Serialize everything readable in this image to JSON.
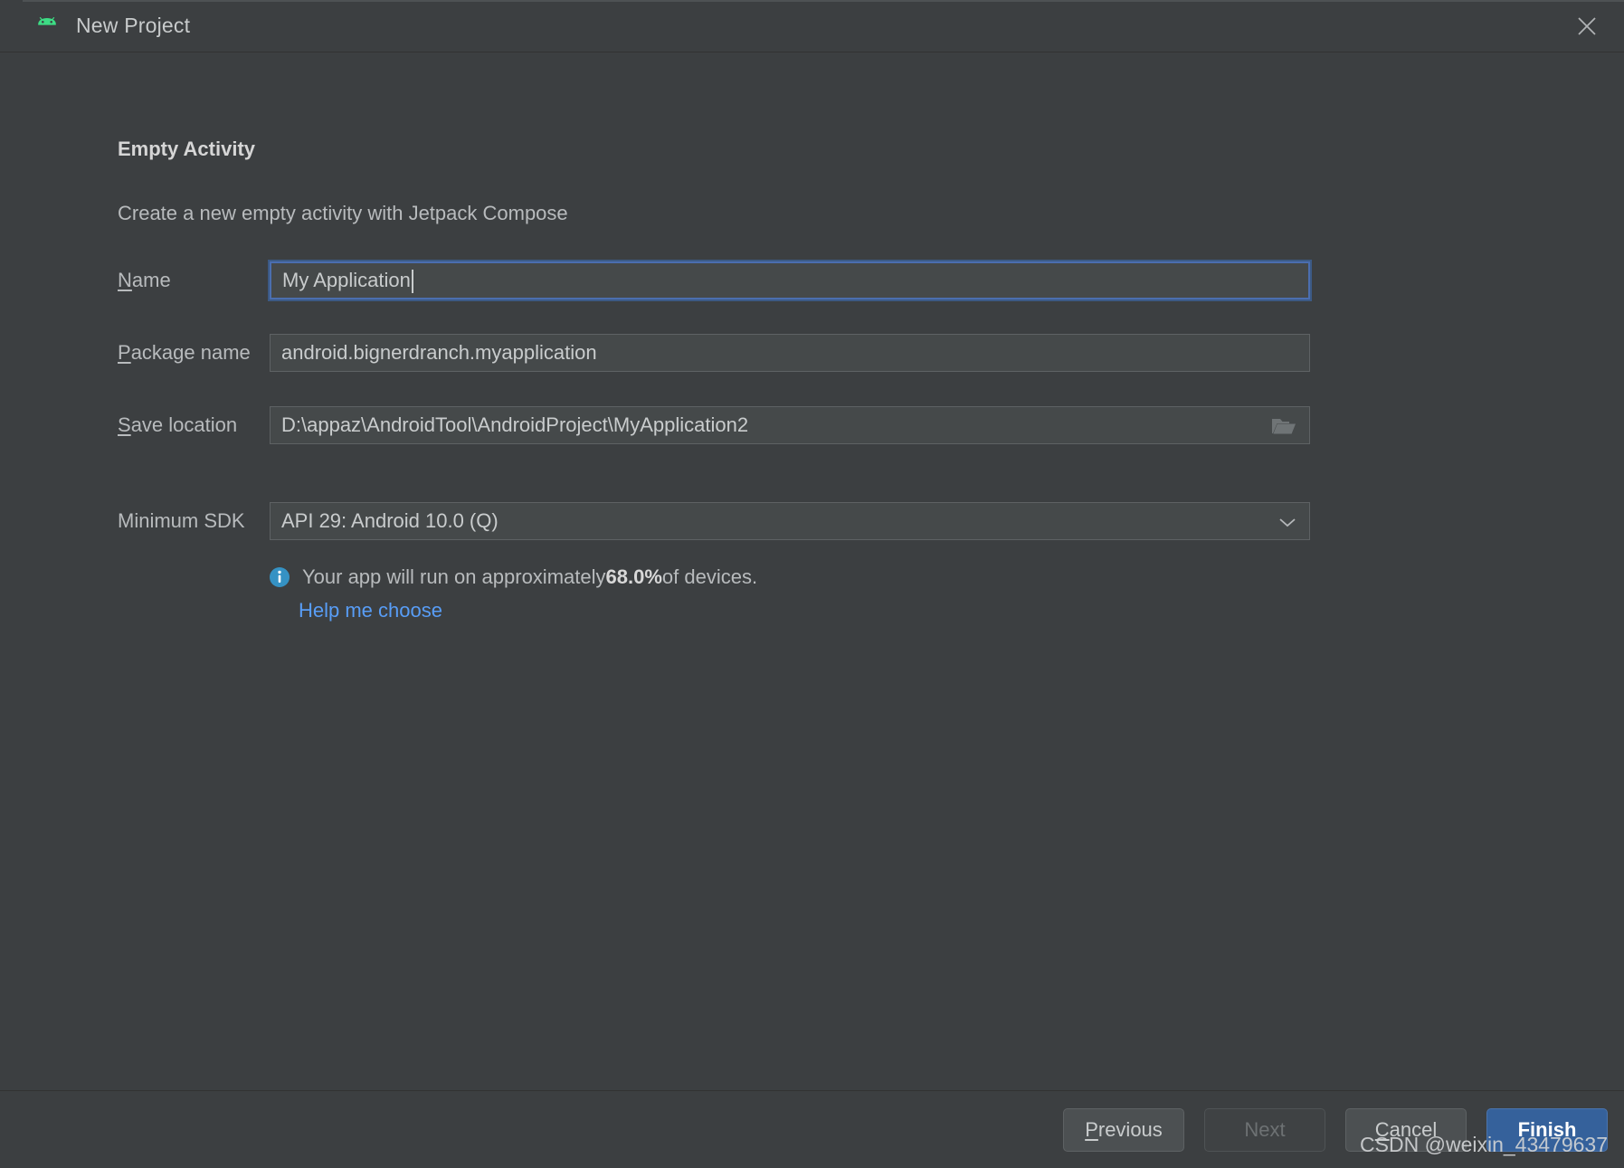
{
  "window": {
    "title": "New Project",
    "app_icon": "android-robot-icon",
    "close_icon": "close-icon"
  },
  "step": {
    "title": "Empty Activity",
    "description": "Create a new empty activity with Jetpack Compose"
  },
  "form": {
    "name": {
      "label_mnemonic": "N",
      "label_rest": "ame",
      "value": "My Application",
      "focused": true
    },
    "package": {
      "label_mnemonic": "P",
      "label_rest": "ackage name",
      "value": "android.bignerdranch.myapplication"
    },
    "save_location": {
      "label_mnemonic": "S",
      "label_rest": "ave location",
      "value": "D:\\appaz\\AndroidTool\\AndroidProject\\MyApplication2",
      "browse_icon": "folder-open-icon"
    },
    "minimum_sdk": {
      "label": "Minimum SDK",
      "value": "API 29: Android 10.0 (Q)",
      "dropdown_icon": "chevron-down-icon"
    }
  },
  "info": {
    "icon": "info-icon",
    "text_before": "Your app will run on approximately ",
    "percent": "68.0%",
    "text_after": " of devices.",
    "help_link": "Help me choose"
  },
  "footer": {
    "previous": {
      "mnemonic": "P",
      "rest": "revious"
    },
    "next": {
      "label": "Next",
      "disabled": true
    },
    "cancel": {
      "mnemonic": "C",
      "rest": "ancel"
    },
    "finish": {
      "label": "Finish",
      "primary": true
    }
  },
  "watermark": "CSDN @weixin_43479637",
  "colors": {
    "background": "#3c3f41",
    "field_background": "#45494a",
    "focus_border": "#4b6eaf",
    "link": "#589df6",
    "primary_button": "#35619b",
    "android_green": "#3ddc84",
    "info_blue": "#3592c4"
  }
}
